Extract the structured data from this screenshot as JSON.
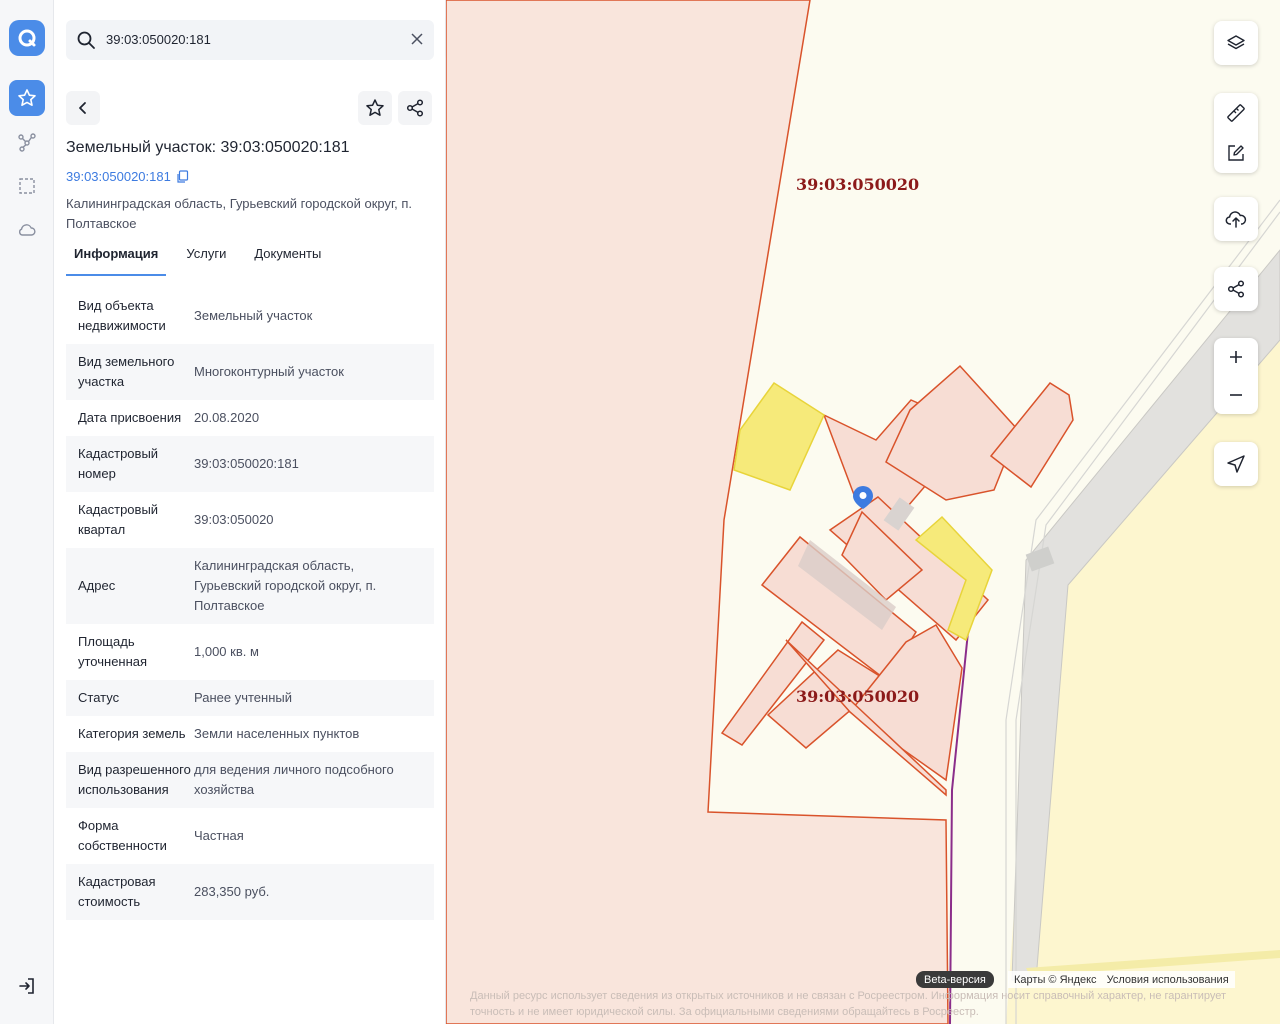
{
  "search": {
    "query": "39:03:050020:181"
  },
  "object": {
    "title": "Земельный участок: 39:03:050020:181",
    "cadastral_link": "39:03:050020:181",
    "address": "Калининградская область, Гурьевский городской округ, п. Полтавское"
  },
  "tabs": [
    {
      "label": "Информация"
    },
    {
      "label": "Услуги"
    },
    {
      "label": "Документы"
    }
  ],
  "info_rows": [
    {
      "key": "Вид объекта недвижимости",
      "value": "Земельный участок"
    },
    {
      "key": "Вид земельного участка",
      "value": "Многоконтурный участок"
    },
    {
      "key": "Дата присвоения",
      "value": "20.08.2020"
    },
    {
      "key": "Кадастровый номер",
      "value": "39:03:050020:181"
    },
    {
      "key": "Кадастровый квартал",
      "value": "39:03:050020"
    },
    {
      "key": "Адрес",
      "value": "Калининградская область, Гурьевский городской округ, п. Полтавское"
    },
    {
      "key": "Площадь уточненная",
      "value": "1,000 кв. м"
    },
    {
      "key": "Статус",
      "value": "Ранее учтенный"
    },
    {
      "key": "Категория земель",
      "value": "Земли населенных пунктов"
    },
    {
      "key": "Вид разрешенного использования",
      "value": "для ведения личного подсобного хозяйства"
    },
    {
      "key": "Форма собственности",
      "value": "Частная"
    },
    {
      "key": "Кадастровая стоимость",
      "value": "283,350 руб."
    }
  ],
  "map": {
    "quarter_label_top": "39:03:050020",
    "quarter_label_bottom": "39:03:050020",
    "beta_badge": "Beta-версия",
    "attribution": "Карты © Яндекс",
    "terms_link": "Условия использования",
    "disclaimer": "Данный ресурс использует сведения из открытых источников и не связан с Росреестром. Информация носит справочный характер, не гарантирует точность и не имеет юридической силы. За официальными сведениями обращайтесь в Росреестр."
  },
  "colors": {
    "accent": "#4b8ce8",
    "parcel_outline": "#d9532b",
    "parcel_fill": "#f7ddd4",
    "selected_parcel": "#f6ea7a",
    "quarter_label": "#8c1a1a"
  }
}
